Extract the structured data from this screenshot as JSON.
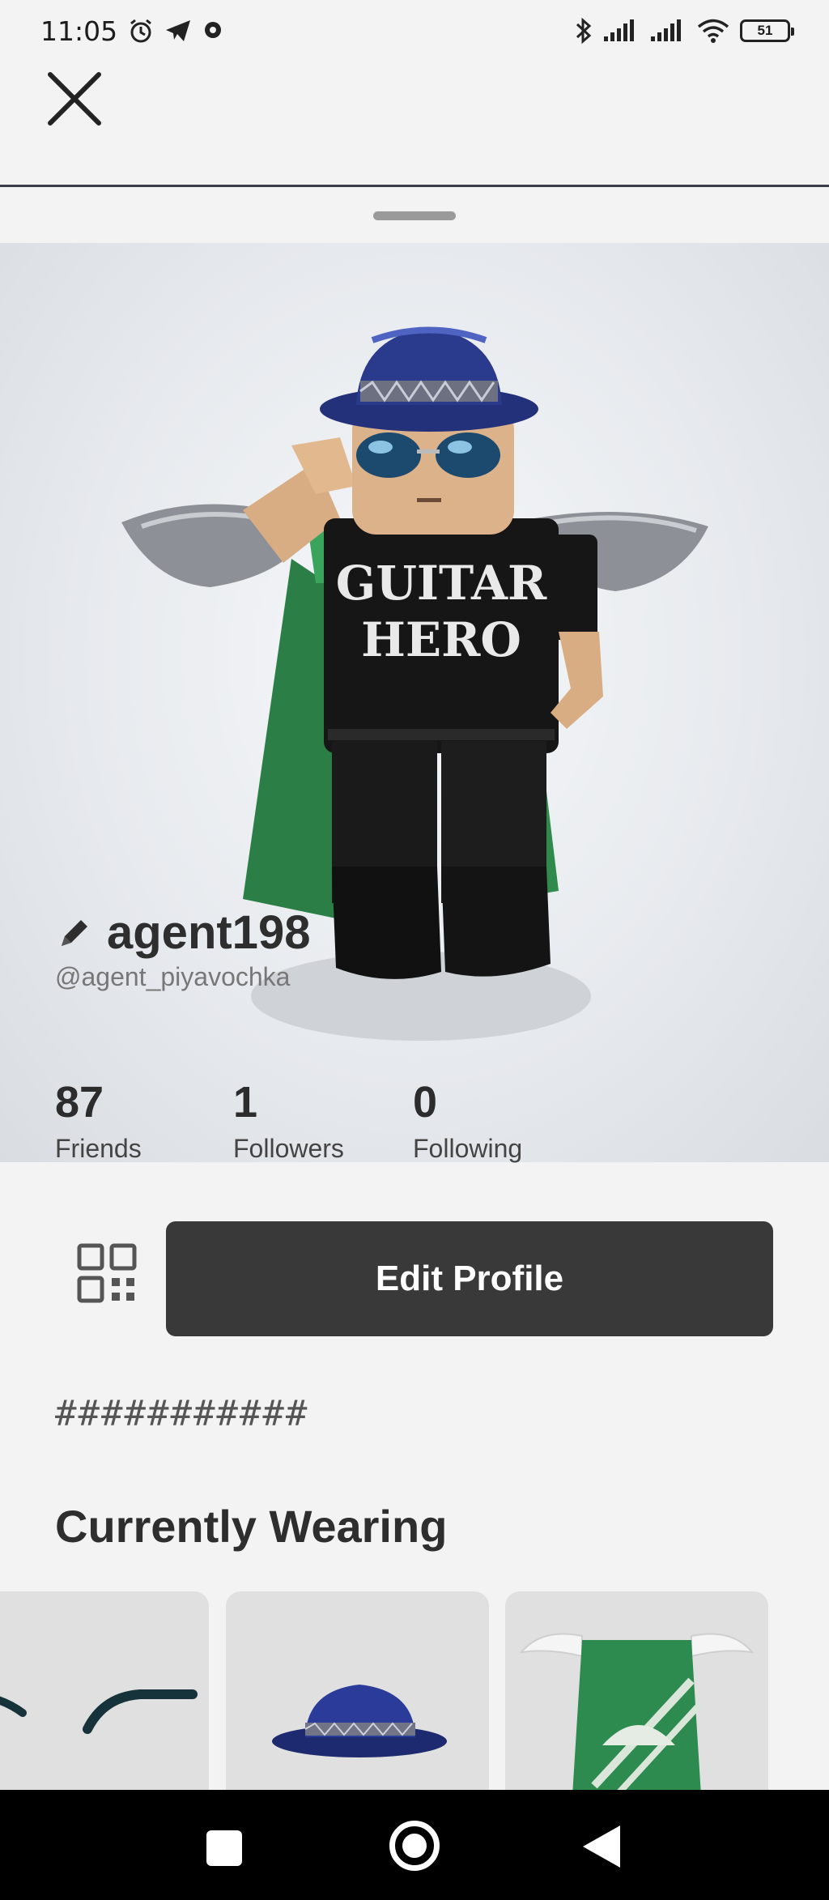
{
  "status_bar": {
    "time": "11:05",
    "battery": "51"
  },
  "profile": {
    "display_name": "agent198",
    "username": "@agent_piyavochka",
    "bio": "###########"
  },
  "stats": [
    {
      "value": "87",
      "label": "Friends"
    },
    {
      "value": "1",
      "label": "Followers"
    },
    {
      "value": "0",
      "label": "Following"
    }
  ],
  "actions": {
    "edit_profile_label": "Edit Profile"
  },
  "sections": {
    "currently_wearing_title": "Currently Wearing"
  },
  "avatar": {
    "shirt_text": [
      "GUITAR",
      "HERO"
    ]
  },
  "colors": {
    "accent_dark": "#393939",
    "cape_green": "#2e8b4f",
    "hat_blue": "#2a3a8c"
  },
  "icons": [
    "close-icon",
    "qr-code-icon",
    "pencil-icon",
    "alarm-icon",
    "telegram-icon",
    "bluetooth-icon",
    "wifi-icon",
    "battery-icon"
  ]
}
